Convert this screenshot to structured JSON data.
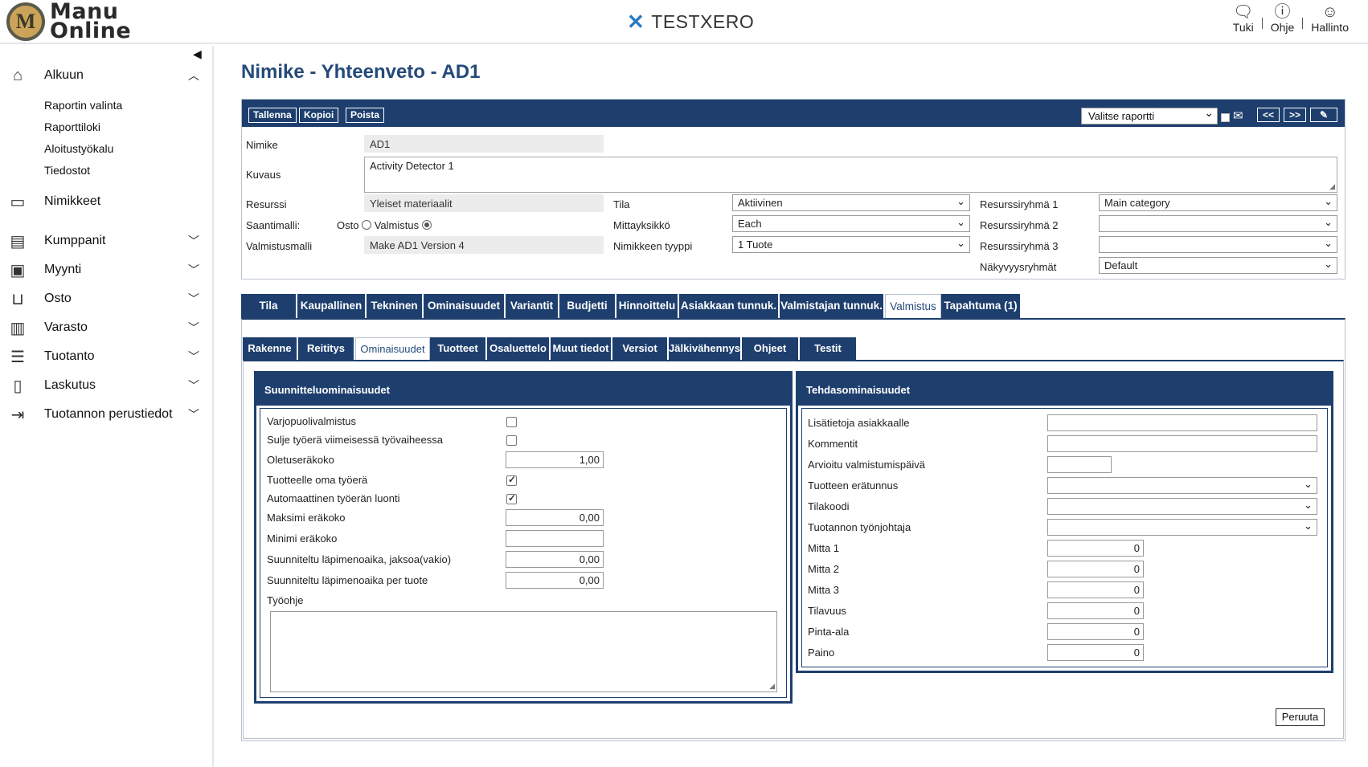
{
  "header": {
    "logo_line1": "Manu",
    "logo_line2": "Online",
    "brand": "TESTXERO",
    "nav": [
      {
        "label": "Tuki",
        "icon": "chat-icon"
      },
      {
        "label": "Ohje",
        "icon": "help-icon"
      },
      {
        "label": "Hallinto",
        "icon": "user-icon"
      }
    ]
  },
  "sidebar": {
    "alkuun": "Alkuun",
    "sub": [
      "Raportin valinta",
      "Raporttiloki",
      "Aloitustyökalu",
      "Tiedostot"
    ],
    "items": [
      "Nimikkeet",
      "Kumppanit",
      "Myynti",
      "Osto",
      "Varasto",
      "Tuotanto",
      "Laskutus",
      "Tuotannon perustiedot"
    ]
  },
  "page": {
    "title": "Nimike - Yhteenveto - AD1"
  },
  "toolbar": {
    "save": "Tallenna",
    "copy": "Kopioi",
    "delete": "Poista",
    "report_select": "Valitse raportti",
    "prev": "<<",
    "next": ">>",
    "attach": "✎"
  },
  "form": {
    "nimike_label": "Nimike",
    "nimike_value": "AD1",
    "kuvaus_label": "Kuvaus",
    "kuvaus_value": "Activity Detector 1",
    "resurssi_label": "Resurssi",
    "resurssi_value": "Yleiset materiaalit",
    "saantimalli_label": "Saantimalli:",
    "osto_label": "Osto",
    "valmistus_label": "Valmistus",
    "valmistusmalli_label": "Valmistusmalli",
    "valmistusmalli_value": "Make AD1 Version 4",
    "tila_label": "Tila",
    "tila_value": "Aktiivinen",
    "mittayksikko_label": "Mittayksikkö",
    "mittayksikko_value": "Each",
    "tyyppi_label": "Nimikkeen tyyppi",
    "tyyppi_value": "1 Tuote",
    "rr1_label": "Resurssiryhmä 1",
    "rr1_value": "Main category",
    "rr2_label": "Resurssiryhmä 2",
    "rr2_value": "",
    "rr3_label": "Resurssiryhmä 3",
    "rr3_value": "",
    "nakyvyys_label": "Näkyvyysryhmät",
    "nakyvyys_value": "Default"
  },
  "tabs": [
    "Tila",
    "Kaupallinen",
    "Tekninen",
    "Ominaisuudet",
    "Variantit",
    "Budjetti",
    "Hinnoittelu",
    "Asiakkaan tunnuk.",
    "Valmistajan tunnuk.",
    "Valmistus",
    "Tapahtuma (1)"
  ],
  "subtabs": [
    "Rakenne",
    "Reititys",
    "Ominaisuudet",
    "Tuotteet",
    "Osaluettelo",
    "Muut tiedot",
    "Versiot",
    "Jälkivähennys",
    "Ohjeet",
    "Testit"
  ],
  "planning": {
    "title": "Suunnitteluominaisuudet",
    "rows": [
      {
        "label": "Varjopuolivalmistus",
        "kind": "checkbox",
        "checked": false
      },
      {
        "label": "Sulje työerä viimeisessä työvaiheessa",
        "kind": "checkbox",
        "checked": false
      },
      {
        "label": "Oletuseräkoko",
        "kind": "number",
        "value": "1,00"
      },
      {
        "label": "Tuotteelle oma työerä",
        "kind": "checkbox",
        "checked": true
      },
      {
        "label": "Automaattinen työerän luonti",
        "kind": "checkbox",
        "checked": true
      },
      {
        "label": "Maksimi eräkoko",
        "kind": "number",
        "value": "0,00"
      },
      {
        "label": "Minimi eräkoko",
        "kind": "number",
        "value": ""
      },
      {
        "label": "Suunniteltu läpimenoaika, jaksoa(vakio)",
        "kind": "number",
        "value": "0,00"
      },
      {
        "label": "Suunniteltu läpimenoaika per tuote",
        "kind": "number",
        "value": "0,00"
      }
    ],
    "workinstr_label": "Työohje"
  },
  "factory": {
    "title": "Tehdasominaisuudet",
    "rows": [
      {
        "label": "Lisätietoja asiakkaalle",
        "kind": "text"
      },
      {
        "label": "Kommentit",
        "kind": "text"
      },
      {
        "label": "Arvioitu valmistumispäivä",
        "kind": "short"
      },
      {
        "label": "Tuotteen erätunnus",
        "kind": "select"
      },
      {
        "label": "Tilakoodi",
        "kind": "select"
      },
      {
        "label": "Tuotannon työnjohtaja",
        "kind": "select"
      },
      {
        "label": "Mitta 1",
        "kind": "number",
        "value": "0"
      },
      {
        "label": "Mitta 2",
        "kind": "number",
        "value": "0"
      },
      {
        "label": "Mitta 3",
        "kind": "number",
        "value": "0"
      },
      {
        "label": "Tilavuus",
        "kind": "number",
        "value": "0"
      },
      {
        "label": "Pinta-ala",
        "kind": "number",
        "value": "0"
      },
      {
        "label": "Paino",
        "kind": "number",
        "value": "0"
      }
    ]
  },
  "cancel": "Peruuta"
}
